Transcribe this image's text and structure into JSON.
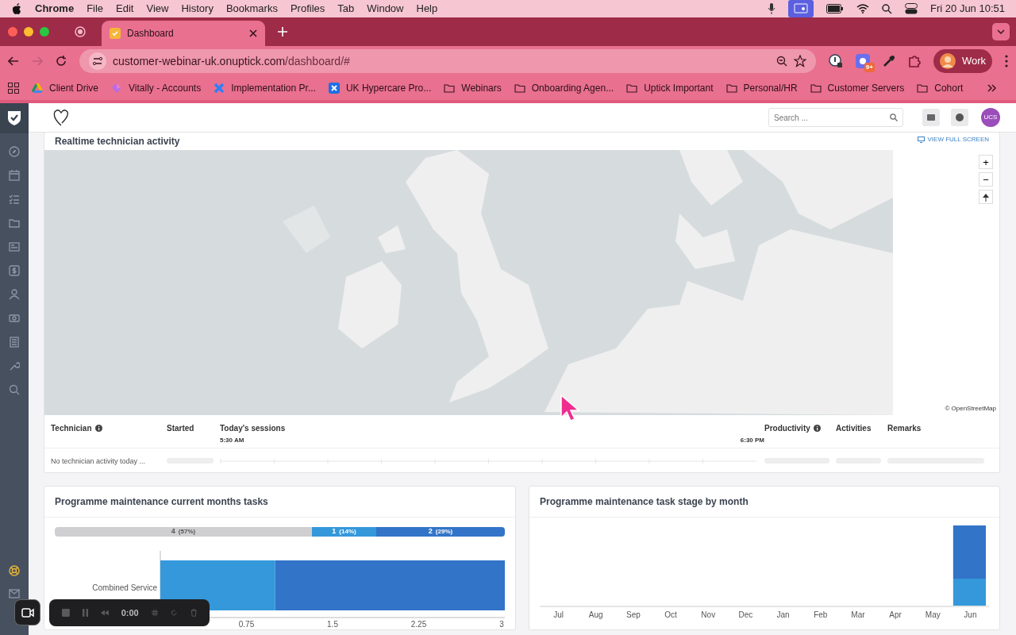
{
  "menubar": {
    "app": "Chrome",
    "items": [
      "File",
      "Edit",
      "View",
      "History",
      "Bookmarks",
      "Profiles",
      "Tab",
      "Window",
      "Help"
    ],
    "clock": "Fri 20 Jun  10:51"
  },
  "browser": {
    "tabs": [
      {
        "title": "Dashboard",
        "selected": true
      }
    ],
    "url_host": "customer-webinar-uk.onuptick.com",
    "url_path": "/dashboard/#",
    "extension_badge": "9+",
    "profile": "Work",
    "bookmarks": [
      {
        "label": "Client Drive",
        "kind": "drive"
      },
      {
        "label": "Vitally - Accounts",
        "kind": "gem"
      },
      {
        "label": "Implementation Pr...",
        "kind": "cross"
      },
      {
        "label": "UK Hypercare Pro...",
        "kind": "cross-box"
      },
      {
        "label": "Webinars",
        "kind": "folder"
      },
      {
        "label": "Onboarding Agen...",
        "kind": "folder"
      },
      {
        "label": "Uptick Important",
        "kind": "folder"
      },
      {
        "label": "Personal/HR",
        "kind": "folder"
      },
      {
        "label": "Customer Servers",
        "kind": "folder"
      },
      {
        "label": "Cohort",
        "kind": "folder"
      }
    ]
  },
  "header": {
    "search": {
      "placeholder": "Search ..."
    },
    "avatar": "UCS"
  },
  "map_card": {
    "title": "Realtime technician activity",
    "link": "VIEW FULL SCREEN",
    "zoom": [
      "+",
      "−"
    ],
    "attribution": "© OpenStreetMap"
  },
  "table": {
    "columns": [
      {
        "label": "Technician",
        "info": true
      },
      {
        "label": "Started",
        "info": false
      },
      {
        "label": "Today's sessions",
        "info": false,
        "start": "5:30 AM",
        "end": "6:30 PM"
      },
      {
        "label": "Productivity",
        "info": true
      },
      {
        "label": "Activities",
        "info": false
      },
      {
        "label": "Remarks",
        "info": false
      }
    ],
    "empty": "No technician activity today ..."
  },
  "tasks_card": {
    "title": "Programme maintenance current months tasks",
    "summary": [
      {
        "count": "4",
        "percent": "(57%)",
        "color": "#cfcfd1"
      },
      {
        "count": "1",
        "percent": "(14%)",
        "color": "#3498db"
      },
      {
        "count": "2",
        "percent": "(29%)",
        "color": "#3274c8"
      }
    ],
    "chart_data": {
      "type": "bar",
      "orientation": "horizontal",
      "stacked": true,
      "categories": [
        "Combined Service"
      ],
      "series": [
        {
          "color": "#3498db",
          "values": [
            1
          ]
        },
        {
          "color": "#3274c8",
          "values": [
            2
          ]
        }
      ],
      "xlim": [
        0,
        3
      ],
      "xticks": [
        0.75,
        1.5,
        2.25,
        3
      ]
    }
  },
  "stage_card": {
    "title": "Programme maintenance task stage by month",
    "months": [
      "Jul",
      "Aug",
      "Sep",
      "Oct",
      "Nov",
      "Dec",
      "Jan",
      "Feb",
      "Mar",
      "Apr",
      "May",
      "Jun"
    ]
  },
  "recorder": {
    "time": "0:00"
  }
}
